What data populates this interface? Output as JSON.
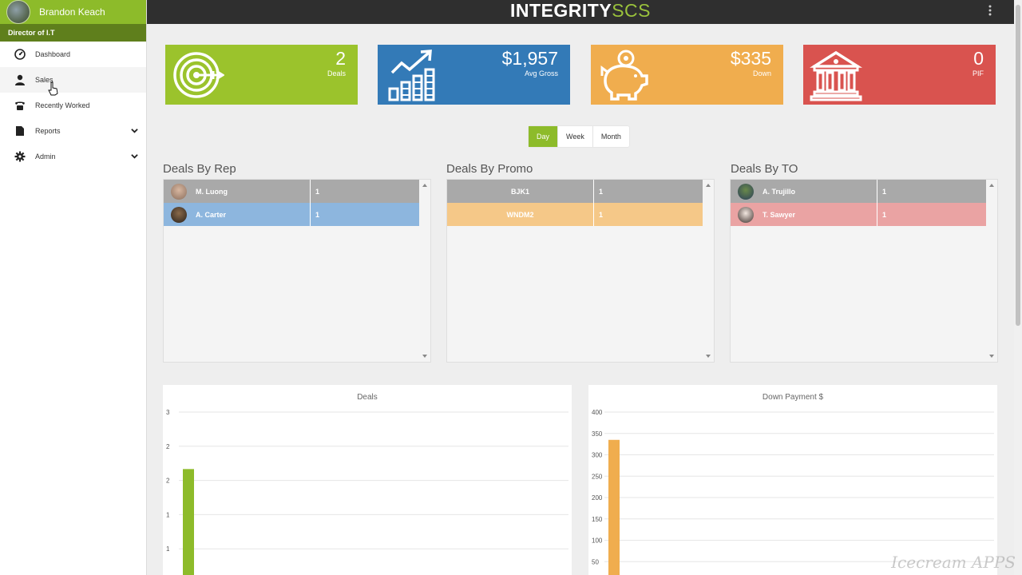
{
  "app": {
    "brand_main": "INTEGRITY",
    "brand_sub": "SCS"
  },
  "user": {
    "name": "Brandon Keach",
    "role": "Director of I.T"
  },
  "sidebar": {
    "items": [
      {
        "label": "Dashboard",
        "icon": "dashboard-gauge-icon"
      },
      {
        "label": "Sales",
        "icon": "user-icon"
      },
      {
        "label": "Recently Worked",
        "icon": "phone-icon"
      },
      {
        "label": "Reports",
        "icon": "document-icon",
        "has_submenu": true
      },
      {
        "label": "Admin",
        "icon": "gear-icon",
        "has_submenu": true
      }
    ]
  },
  "stats": [
    {
      "value": "2",
      "label": "Deals",
      "color": "#9bc32c",
      "icon": "target-icon"
    },
    {
      "value": "$1,957",
      "label": "Avg Gross",
      "color": "#337ab7",
      "icon": "growth-chart-icon"
    },
    {
      "value": "$335",
      "label": "Down",
      "color": "#f0ad4e",
      "icon": "piggy-bank-icon"
    },
    {
      "value": "0",
      "label": "PIF",
      "color": "#d9534f",
      "icon": "bank-icon"
    }
  ],
  "period_tabs": {
    "items": [
      "Day",
      "Week",
      "Month"
    ],
    "active": "Day"
  },
  "panels": {
    "by_rep": {
      "title": "Deals By Rep",
      "rows": [
        {
          "name": "M. Luong",
          "count": "1",
          "color": "#a9a9a9"
        },
        {
          "name": "A. Carter",
          "count": "1",
          "color": "#8db6de"
        }
      ]
    },
    "by_promo": {
      "title": "Deals By Promo",
      "rows": [
        {
          "name": "BJK1",
          "count": "1",
          "color": "#a9a9a9"
        },
        {
          "name": "WNDM2",
          "count": "1",
          "color": "#f5c888"
        }
      ]
    },
    "by_to": {
      "title": "Deals By TO",
      "rows": [
        {
          "name": "A. Trujillo",
          "count": "1",
          "color": "#a9a9a9"
        },
        {
          "name": "T. Sawyer",
          "count": "1",
          "color": "#eaa3a3"
        }
      ]
    }
  },
  "chart_data": [
    {
      "type": "bar",
      "title": "Deals",
      "y_tick_labels": [
        "3",
        "2",
        "2",
        "1",
        "1"
      ],
      "ylim": [
        0,
        3
      ],
      "grid": true,
      "series": [
        {
          "values": [
            2
          ]
        }
      ],
      "color": "#8dbb2a"
    },
    {
      "type": "bar",
      "title": "Down Payment $",
      "y_tick_labels": [
        "400",
        "350",
        "300",
        "250",
        "200",
        "150",
        "100",
        "50"
      ],
      "ylim": [
        0,
        400
      ],
      "grid": true,
      "series": [
        {
          "values": [
            335
          ]
        }
      ],
      "color": "#f0ad4e"
    }
  ],
  "watermark": "Icecream APPS"
}
